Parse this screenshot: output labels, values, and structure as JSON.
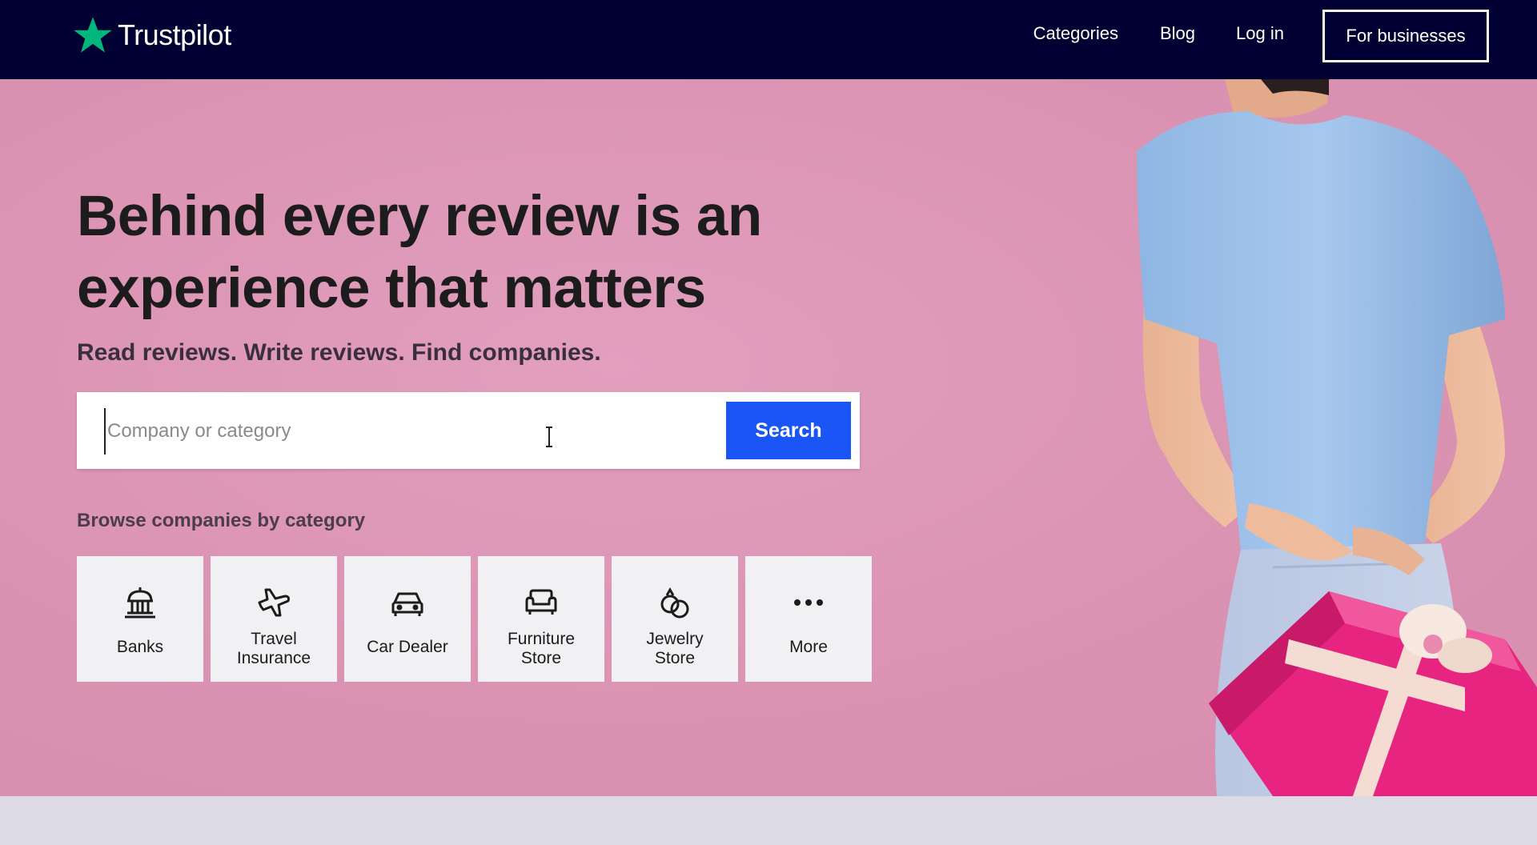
{
  "header": {
    "logo_text": "Trustpilot",
    "nav": [
      {
        "label": "Categories"
      },
      {
        "label": "Blog"
      },
      {
        "label": "Log in"
      }
    ],
    "business_button": "For businesses",
    "background": "#000032",
    "logo_star_color": "#00b67a"
  },
  "hero": {
    "title": "Behind every review is an experience that matters",
    "subtitle": "Read reviews. Write reviews. Find companies.",
    "search": {
      "placeholder": "Company or category",
      "value": "",
      "button_label": "Search"
    },
    "browse_label": "Browse companies by category",
    "categories": [
      {
        "label": "Banks",
        "icon": "bank-icon"
      },
      {
        "label": "Travel\nInsurance",
        "icon": "airplane-icon"
      },
      {
        "label": "Car Dealer",
        "icon": "car-icon"
      },
      {
        "label": "Furniture\nStore",
        "icon": "sofa-icon"
      },
      {
        "label": "Jewelry\nStore",
        "icon": "rings-icon"
      },
      {
        "label": "More",
        "icon": "more-dots-icon"
      }
    ],
    "background": "#dd96b5",
    "accent": "#1c55f5"
  }
}
